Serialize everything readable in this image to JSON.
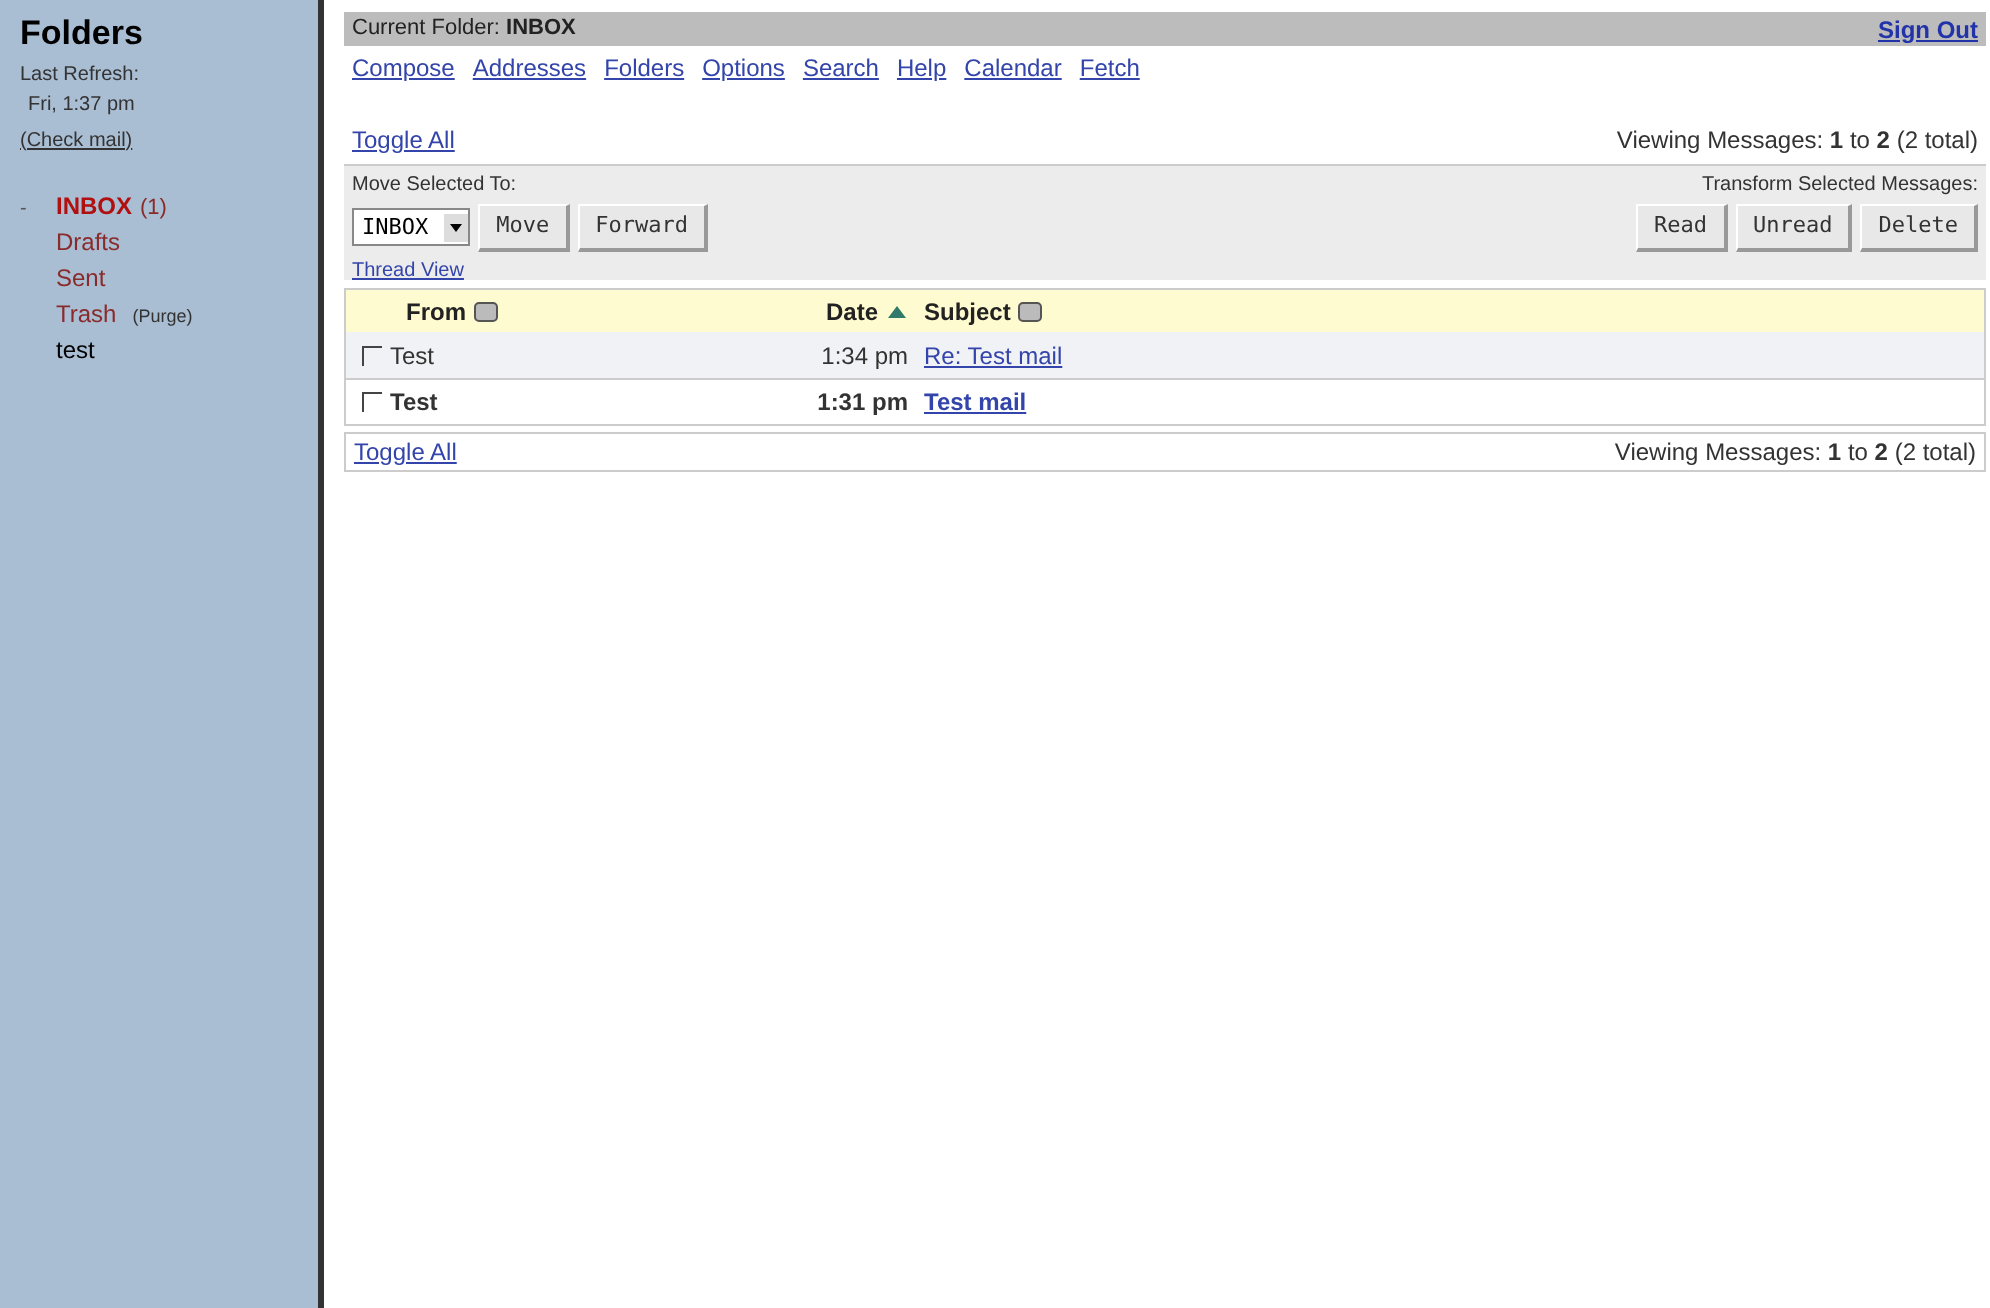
{
  "sidebar": {
    "title": "Folders",
    "refresh_label": "Last Refresh:",
    "refresh_time": "Fri, 1:37 pm",
    "check_mail": "(Check mail)",
    "folders": [
      {
        "name": "INBOX",
        "count": "(1)",
        "marker": "-",
        "selected": true,
        "kind": "special"
      },
      {
        "name": "Drafts",
        "selected": false,
        "kind": "special"
      },
      {
        "name": "Sent",
        "selected": false,
        "kind": "special"
      },
      {
        "name": "Trash",
        "purge": "(Purge)",
        "selected": false,
        "kind": "special"
      },
      {
        "name": "test",
        "selected": false,
        "kind": "user"
      }
    ]
  },
  "header": {
    "current_folder": "Current Folder: **INBOX**",
    "sign_out": "Sign Out"
  },
  "nav": [
    "Compose",
    "Addresses",
    "Folders",
    "Options",
    "Search",
    "Help",
    "Calendar",
    "Fetch"
  ],
  "toggle_all_top": "Toggle All",
  "viewing_top": "Viewing Messages: **1** to **2** (2 total)",
  "actions": {
    "move_label": "Move Selected To:",
    "folder_select": "INBOX",
    "move_buttons": [
      "Move",
      "Forward"
    ],
    "thread_view": "Thread View",
    "transform_label": "Transform Selected Messages:",
    "transform_buttons": [
      "Read",
      "Unread",
      "Delete"
    ]
  },
  "table": {
    "columns": [
      {
        "label": "From",
        "sorted": false
      },
      {
        "label": "Date",
        "sorted": true
      },
      {
        "label": "Subject",
        "sorted": false
      }
    ],
    "rows": [
      {
        "checked": false,
        "unread": false,
        "from": "Test",
        "date": "1:34 pm",
        "subject": "Re: Test mail"
      },
      {
        "checked": false,
        "unread": true,
        "from": "Test",
        "date": "1:31 pm",
        "subject": "Test mail"
      }
    ]
  },
  "toggle_all_bottom": "Toggle All",
  "viewing_bottom": "Viewing Messages: **1** to **2** (2 total)"
}
